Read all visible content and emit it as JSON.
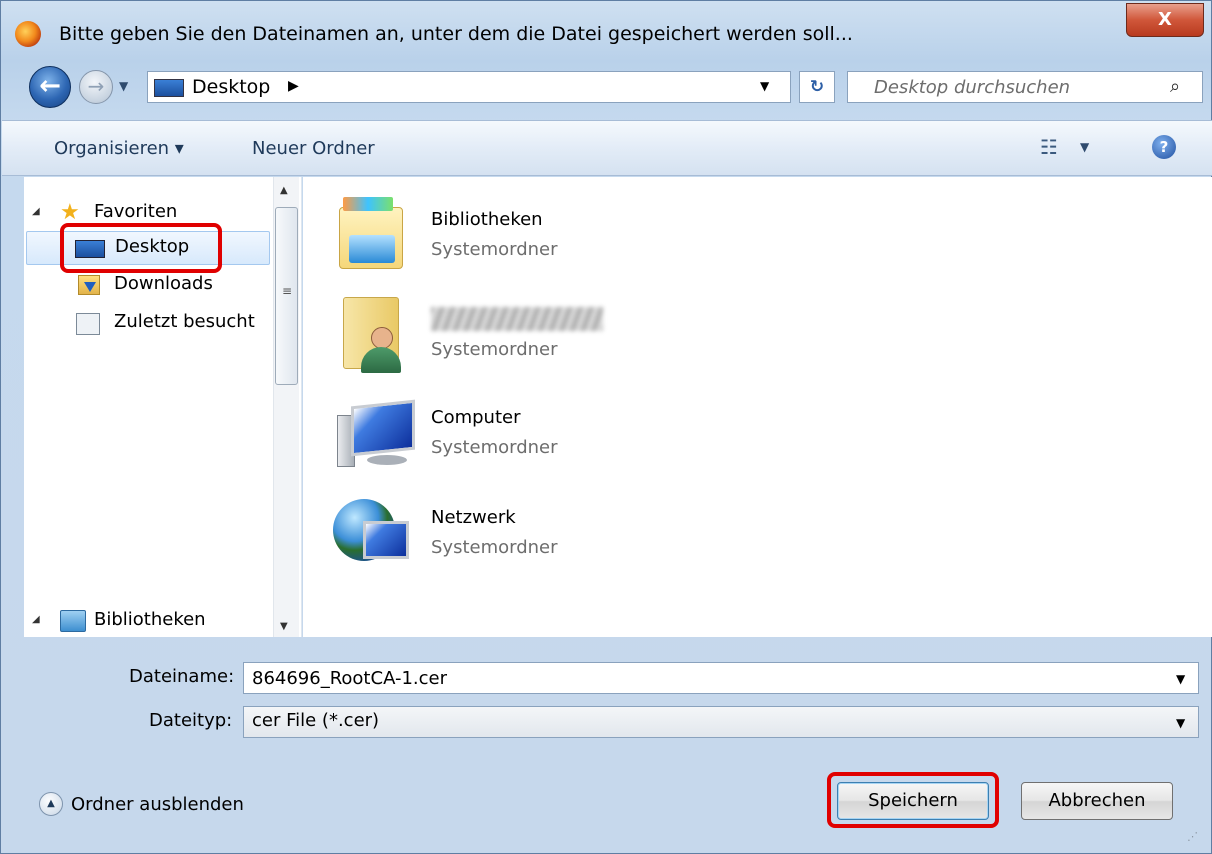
{
  "window": {
    "title": "Bitte geben Sie den Dateinamen an, unter dem die Datei gespeichert werden soll...",
    "close_label": "X"
  },
  "address": {
    "location": "Desktop",
    "search_placeholder": "Desktop durchsuchen"
  },
  "toolbar": {
    "organize_label": "Organisieren ▾",
    "new_folder_label": "Neuer Ordner",
    "help_label": "?"
  },
  "nav": {
    "favorites": "Favoriten",
    "items": [
      {
        "label": "Desktop",
        "icon": "desktop-icon",
        "selected": true
      },
      {
        "label": "Downloads",
        "icon": "downloads-icon"
      },
      {
        "label": "Zuletzt besucht",
        "icon": "recent-places-icon"
      }
    ],
    "libraries": "Bibliotheken"
  },
  "files": [
    {
      "name": "Bibliotheken",
      "type": "Systemordner",
      "icon": "libraries-icon"
    },
    {
      "name": "",
      "type": "Systemordner",
      "icon": "user-folder-icon",
      "name_redacted": true
    },
    {
      "name": "Computer",
      "type": "Systemordner",
      "icon": "computer-icon"
    },
    {
      "name": "Netzwerk",
      "type": "Systemordner",
      "icon": "network-icon"
    }
  ],
  "form": {
    "filename_label": "Dateiname:",
    "filename_value": "864696_RootCA-1.cer",
    "filetype_label": "Dateityp:",
    "filetype_value": "cer File (*.cer)"
  },
  "footer": {
    "hide_folders_label": "Ordner ausblenden",
    "save_label": "Speichern",
    "cancel_label": "Abbrechen"
  },
  "colors": {
    "highlight_box": "#e00000",
    "selection": "#d7e9fc"
  }
}
